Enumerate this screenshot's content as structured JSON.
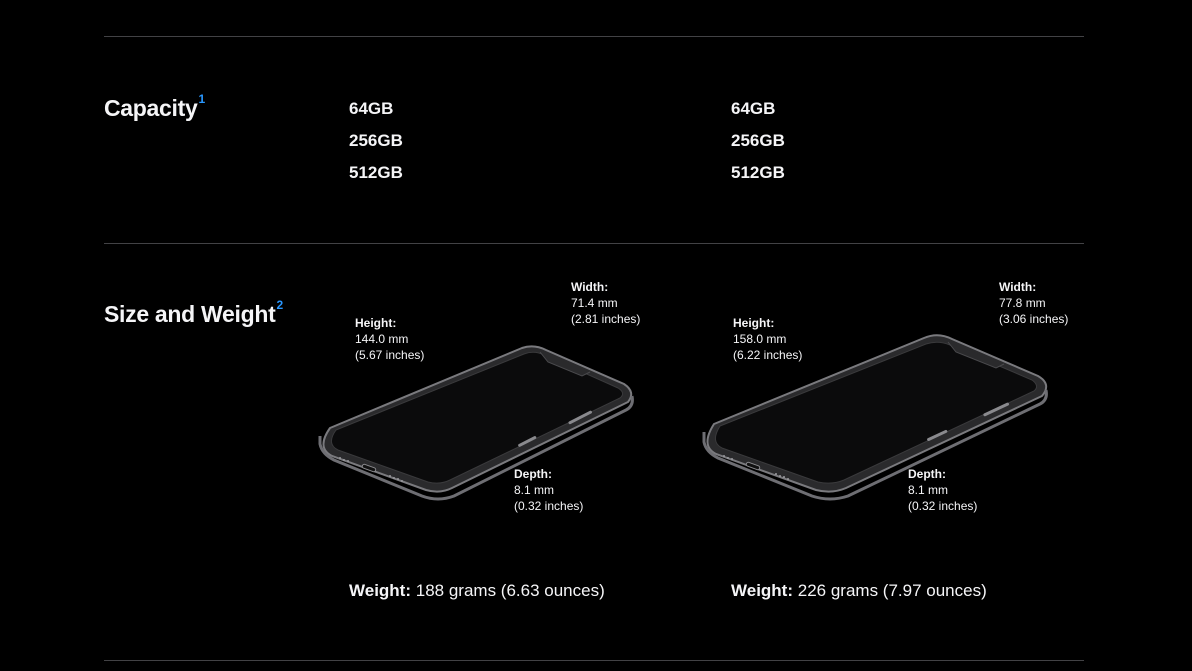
{
  "capacity": {
    "title": "Capacity",
    "footnote": "1",
    "models": [
      {
        "options": [
          "64GB",
          "256GB",
          "512GB"
        ]
      },
      {
        "options": [
          "64GB",
          "256GB",
          "512GB"
        ]
      }
    ]
  },
  "size_weight": {
    "title": "Size and Weight",
    "footnote": "2",
    "models": [
      {
        "height_label": "Height:",
        "height_mm": "144.0 mm",
        "height_in": "(5.67 inches)",
        "width_label": "Width:",
        "width_mm": "71.4 mm",
        "width_in": "(2.81 inches)",
        "depth_label": "Depth:",
        "depth_mm": "8.1 mm",
        "depth_in": "(0.32 inches)",
        "weight_label": "Weight:",
        "weight_value": "188 grams (6.63 ounces)"
      },
      {
        "height_label": "Height:",
        "height_mm": "158.0 mm",
        "height_in": "(6.22 inches)",
        "width_label": "Width:",
        "width_mm": "77.8 mm",
        "width_in": "(3.06 inches)",
        "depth_label": "Depth:",
        "depth_mm": "8.1 mm",
        "depth_in": "(0.32 inches)",
        "weight_label": "Weight:",
        "weight_value": "226 grams (7.97 ounces)"
      }
    ]
  },
  "colors": {
    "background": "#000000",
    "text": "#f5f5f7",
    "footnote": "#2997ff",
    "divider": "#424245"
  },
  "icons": [
    "phone-illustration"
  ]
}
